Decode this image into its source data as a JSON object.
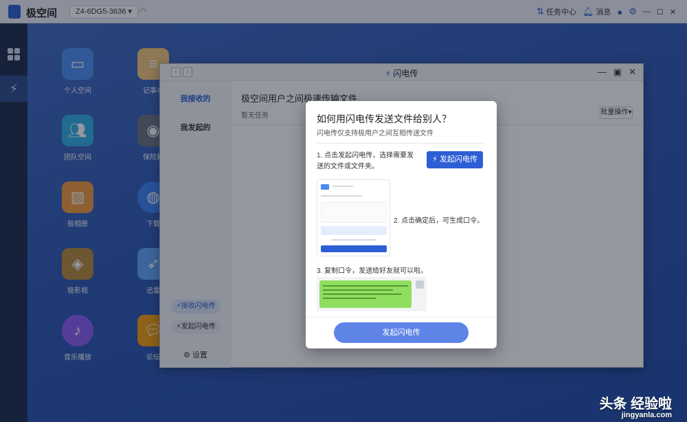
{
  "topbar": {
    "app_name": "极空间",
    "device": "Z4-6DG5-3636",
    "tasks": "任务中心",
    "messages": "消息"
  },
  "desktop_icons": [
    {
      "label": "个人空间",
      "icon": "folder-icon",
      "color": "#4d8ff2"
    },
    {
      "label": "团队空间",
      "icon": "team-folder-icon",
      "color": "#2fb0e8"
    },
    {
      "label": "极相册",
      "icon": "photo-icon",
      "color": "#f29a3d"
    },
    {
      "label": "极影视",
      "icon": "video-icon",
      "color": "#b88a3a"
    },
    {
      "label": "音乐播放",
      "icon": "music-icon",
      "color": "#8b5cf6"
    },
    {
      "label": "记事本",
      "icon": "notes-icon",
      "color": "#f6c77b"
    },
    {
      "label": "保险箱",
      "icon": "safe-icon",
      "color": "#6b7280"
    },
    {
      "label": "下载",
      "icon": "globe-icon",
      "color": "#3b82f6"
    },
    {
      "label": "迅雷",
      "icon": "bird-icon",
      "color": "#60a5fa"
    },
    {
      "label": "论坛",
      "icon": "chat-icon",
      "color": "#f59e0b"
    }
  ],
  "window": {
    "title": "闪电传",
    "nav": {
      "received": "我接收的",
      "sent": "我发起的"
    },
    "side_buttons": {
      "receive": "接收闪电传",
      "send": "发起闪电传",
      "settings": "设置"
    },
    "main": {
      "heading": "极空间用户之间极速传输文件",
      "empty": "暂无任务",
      "batch": "批量操作"
    }
  },
  "dialog": {
    "title": "如何用闪电传发送文件给别人？",
    "subtitle": "闪电传仅支持极用户之间互相传送文件",
    "step1": "1. 点击发起闪电传，选择需要发送的文件或文件夹。",
    "start_button": "发起闪电传",
    "step2": "2. 点击确定后，可生成口令。",
    "step3": "3. 复制口令，发送给好友就可以啦。",
    "confirm_button": "发起闪电传"
  },
  "watermark": {
    "line1": "头条 经验啦",
    "line2": "jingyanla.com"
  }
}
